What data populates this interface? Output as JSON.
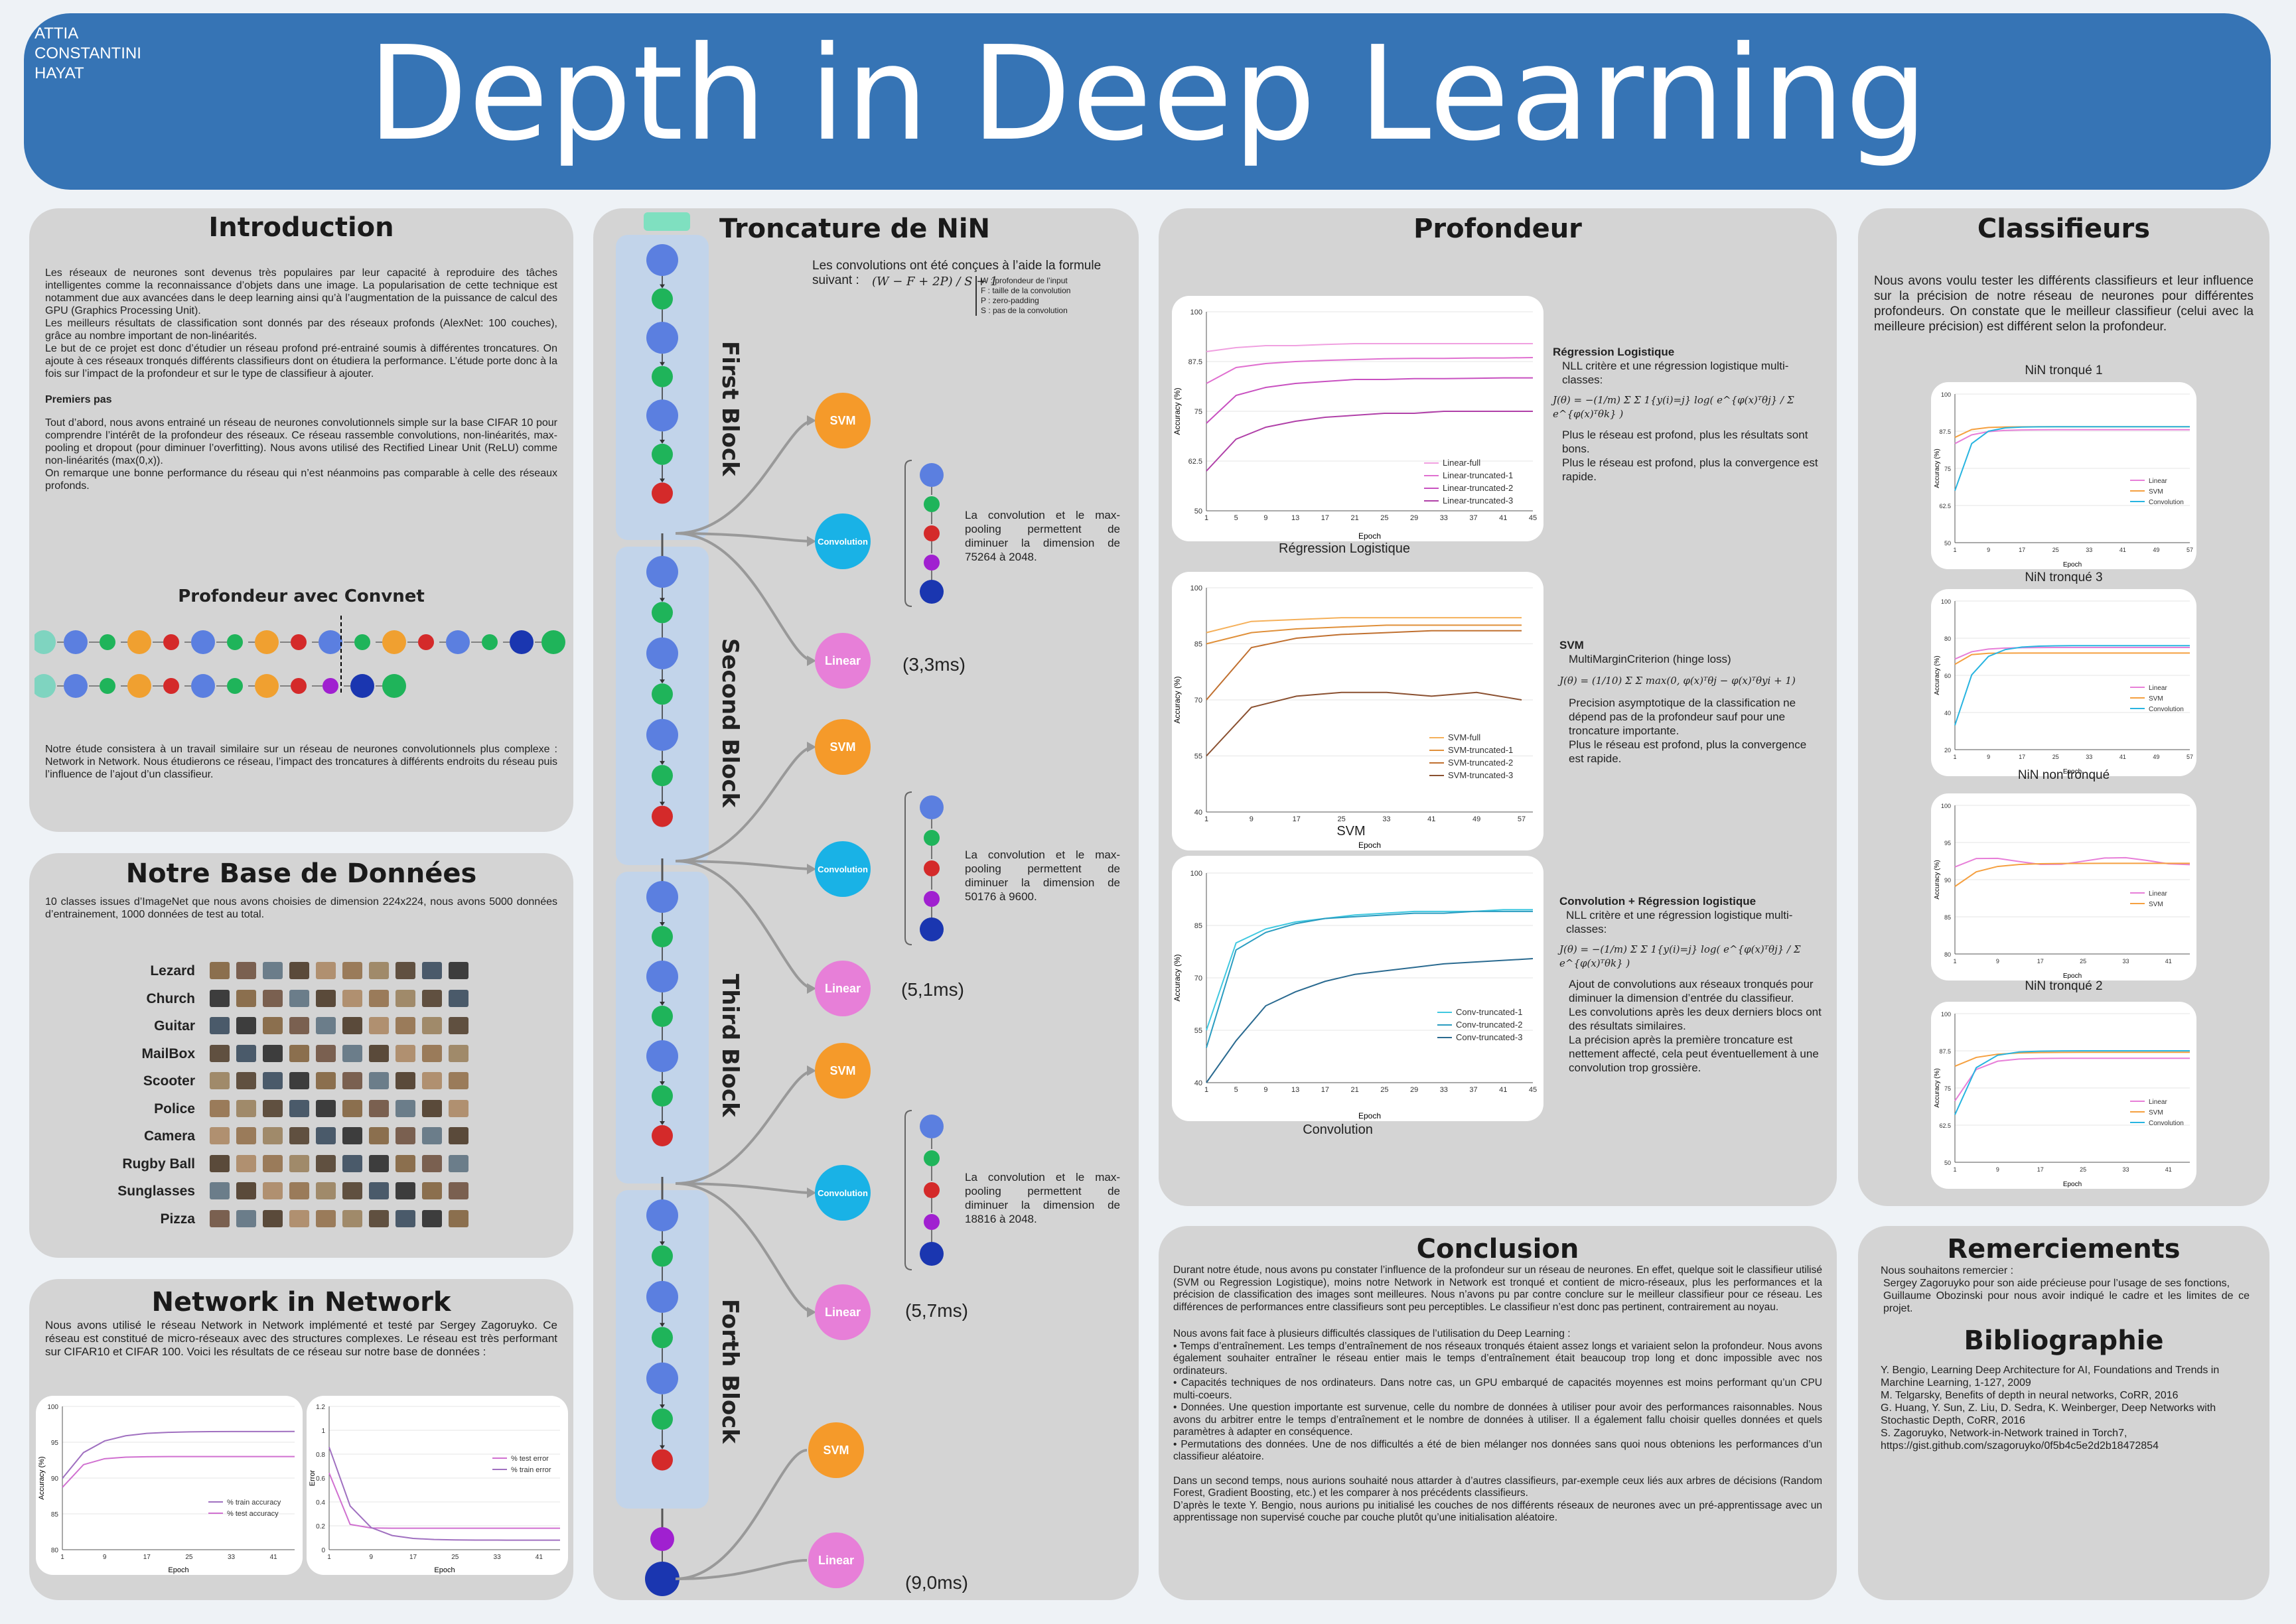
{
  "header": {
    "authors": [
      "ATTIA",
      "CONSTANTINI",
      "HAYAT"
    ],
    "title": "Depth in Deep Learning"
  },
  "intro": {
    "title": "Introduction",
    "p1": "Les réseaux de neurones sont devenus très populaires par leur capacité à reproduire des tâches intelligentes comme la reconnaissance d’objets dans une image. La popularisation de cette technique est notamment due aux avancées dans le deep learning ainsi qu’à l’augmentation de la puissance de calcul des GPU (Graphics Processing Unit).",
    "p2": "Les meilleurs résultats de classification sont donnés par des réseaux profonds (AlexNet: 100 couches), grâce au nombre important de non-linéarités.",
    "p3": "Le but de ce projet est donc d’étudier un réseau profond pré-entrainé soumis à différentes troncatures. On ajoute à ces réseaux tronqués différents classifieurs dont on étudiera la performance. L’étude porte donc à la fois sur l’impact de la profondeur et sur le type de classifieur à ajouter.",
    "subtitle": "Premiers pas",
    "p4": "Tout d’abord, nous avons entrainé un réseau de neurones convolutionnels simple sur la base CIFAR 10 pour comprendre l’intérêt de la profondeur des réseaux. Ce réseau rassemble convolutions, non-linéarités, max-pooling et dropout (pour diminuer l’overfitting). Nous avons utilisé des Rectified Linear Unit (ReLU) comme non-linéarités (max(0,x)).",
    "p5": "On remarque une bonne performance du réseau qui n’est néanmoins pas comparable à celle des réseaux profonds.",
    "convnet_title": "Profondeur avec Convnet",
    "p6": "Notre étude consistera à un travail similaire sur un réseau de neurones convolutionnels plus complexe : Network in Network. Nous étudierons ce réseau, l’impact des troncatures à différents endroits du réseau puis l’influence de l’ajout d’un classifieur."
  },
  "database": {
    "title": "Notre Base de Données",
    "text": "10 classes issues d’ImageNet que nous avons choisies de dimension 224x224, nous avons 5000 données d’entrainement, 1000 données de test au total.",
    "classes": [
      "Lezard",
      "Church",
      "Guitar",
      "MailBox",
      "Scooter",
      "Police",
      "Camera",
      "Rugby Ball",
      "Sunglasses",
      "Pizza"
    ]
  },
  "nin": {
    "title": "Network in Network",
    "text": "Nous avons utilisé le réseau Network in Network implémenté et testé par Sergey Zagoruyko. Ce réseau est constitué de micro-réseaux avec des structures complexes. Le réseau est très performant sur CIFAR10 et CIFAR 100. Voici les résultats de ce réseau sur notre base de données :",
    "chart1_legend": [
      "% train accuracy",
      "% test accuracy"
    ],
    "chart2_legend": [
      "% test error",
      "% train error"
    ],
    "xlabel": "Epoch",
    "ylabel1": "Accuracy (%)",
    "ylabel2": "Error"
  },
  "troncature": {
    "title": "Troncature de NiN",
    "formula_intro": "Les convolutions ont été conçues à l’aide la formule suivant :",
    "formula": "(W − F + 2P) / S + 1",
    "formula_notes": [
      "W : profondeur de l’input",
      "F : taille de la convolution",
      "P : zero-padding",
      "S : pas de la convolution"
    ],
    "blocks": [
      "First Block",
      "Second Block",
      "Third Block",
      "Forth Block"
    ],
    "svm": "SVM",
    "conv": "Convolution",
    "linear": "Linear",
    "desc1": "La convolution et le max-pooling permettent de diminuer la dimension de 75264 à 2048.",
    "desc2": "La convolution et le max-pooling permettent de diminuer la dimension de 50176 à 9600.",
    "desc3": "La convolution et le max-pooling permettent de diminuer la dimension de 18816 à 2048.",
    "times": [
      "(3,3ms)",
      "(5,1ms)",
      "(5,7ms)",
      "(9,0ms)"
    ]
  },
  "profondeur": {
    "title": "Profondeur",
    "chart1_caption": "Régression Logistique",
    "chart2_caption": "SVM",
    "chart3_caption": "Convolution",
    "xlabel": "Epoch",
    "ylabel": "Accuracy (%)",
    "chart1_legend": [
      "Linear-full",
      "Linear-truncated-1",
      "Linear-truncated-2",
      "Linear-truncated-3"
    ],
    "chart2_legend": [
      "SVM-full",
      "SVM-truncated-1",
      "SVM-truncated-2",
      "SVM-truncated-3"
    ],
    "chart3_legend": [
      "Conv-truncated-1",
      "Conv-truncated-2",
      "Conv-truncated-3"
    ],
    "s1_title": "Régression Logistique",
    "s1_b1": "NLL critère et une régression logistique multi-classes:",
    "s1_formula": "J(θ) = −(1/m) Σ Σ 1{y(i)=j} log( e^{φ(x)ᵀθj} / Σ e^{φ(x)ᵀθk} )",
    "s1_b2": "Plus le réseau est profond, plus les résultats sont bons.",
    "s1_b3": "Plus le réseau est profond, plus la convergence est rapide.",
    "s2_title": "SVM",
    "s2_b1": "MultiMarginCriterion (hinge loss)",
    "s2_formula": "J(θ) = (1/10) Σ Σ max(0, φ(x)ᵀθj − φ(x)ᵀθyi + 1)",
    "s2_b2": "Precision asymptotique de la classification ne dépend pas de la profondeur sauf pour une troncature importante.",
    "s2_b3": "Plus le réseau est profond, plus la convergence est rapide.",
    "s3_title": "Convolution + Régression logistique",
    "s3_b1": "NLL critère et une régression logistique multi-classes:",
    "s3_formula": "J(θ) = −(1/m) Σ Σ 1{y(i)=j} log( e^{φ(x)ᵀθj} / Σ e^{φ(x)ᵀθk} )",
    "s3_b2": "Ajout de convolutions aux réseaux tronqués pour diminuer la dimension d’entrée du classifieur.",
    "s3_b3": "Les convolutions après les deux derniers blocs ont des résultats similaires.",
    "s3_b4": "La précision après la première troncature est nettement affecté, cela peut éventuellement à une convolution trop grossière."
  },
  "classifieurs": {
    "title": "Classifieurs",
    "text": "Nous avons voulu tester les différents classifieurs et leur influence sur la précision de notre réseau de neurones pour différentes profondeurs. On constate que le meilleur classifieur (celui avec la meilleure précision) est différent selon la profondeur.",
    "charts": [
      {
        "title": "NiN tronqué 1",
        "legend": [
          "Linear",
          "SVM",
          "Convolution"
        ]
      },
      {
        "title": "NiN tronqué 3",
        "legend": [
          "Linear",
          "SVM",
          "Convolution"
        ]
      },
      {
        "title": "NiN non tronqué",
        "legend": [
          "Linear",
          "SVM"
        ]
      },
      {
        "title": "NiN tronqué 2",
        "legend": [
          "Linear",
          "SVM",
          "Convolution"
        ]
      }
    ],
    "xlabel": "Epoch",
    "ylabel": "Accuracy (%)"
  },
  "conclusion": {
    "title": "Conclusion",
    "p1": "Durant notre étude, nous avons pu constater l’influence de la profondeur sur un réseau de neurones. En effet, quelque soit le classifieur utilisé (SVM ou Regression Logistique), moins notre Network in Network est tronqué et contient de micro-réseaux, plus les performances et la précision de classification des images sont meilleures. Nous n’avons pu par contre conclure sur le meilleur classifieur pour ce réseau. Les différences de performances entre classifieurs sont peu perceptibles. Le classifieur n’est donc pas pertinent, contrairement au noyau.",
    "p2": "Nous avons fait face à plusieurs difficultés classiques de l’utilisation du Deep Learning :",
    "b1": "• Temps d’entraînement. Les temps d’entraînement de nos réseaux tronqués étaient assez longs et variaient selon la profondeur. Nous avons également souhaiter entraîner le réseau entier mais le temps d’entraînement était beaucoup trop long et donc impossible avec nos ordinateurs.",
    "b2": "• Capacités techniques de nos ordinateurs. Dans notre cas, un GPU embarqué de capacités moyennes est moins performant qu’un CPU multi-coeurs.",
    "b3": "• Données. Une question importante est survenue, celle du nombre de données à utiliser pour avoir des performances raisonnables. Nous avons du arbitrer entre le temps d’entraînement et le nombre de données à utiliser. Il a également fallu choisir quelles données et quels paramètres à adapter en conséquence.",
    "b4": "• Permutations des données. Une de nos difficultés a été de bien mélanger nos données sans quoi nous obtenions les performances d’un classifieur aléatoire.",
    "p3": "Dans un second temps, nous aurions souhaité nous attarder à d’autres classifieurs, par-exemple ceux liés aux arbres de décisions (Random Forest, Gradient Boosting, etc.) et les comparer à nos précédents classifieurs.",
    "p4": "D’après le texte Y. Bengio, nous aurions pu initialisé les couches de nos différents réseaux de neurones avec un pré-apprentissage avec un apprentissage non supervisé couche par couche plutôt qu’une initialisation aléatoire."
  },
  "remerciements": {
    "title": "Remerciements",
    "intro": "Nous souhaitons remercier :",
    "r1": "Sergey Zagoruyko pour son aide précieuse pour l’usage de ses fonctions,",
    "r2": "Guillaume Obozinski pour nous avoir indiqué le cadre et les limites de ce projet."
  },
  "bibliographie": {
    "title": "Bibliographie",
    "refs": [
      "Y. Bengio, Learning Deep Architecture for AI, Foundations and Trends in Marchine Learning, 1-127, 2009",
      "M. Telgarsky, Benefits of depth in neural networks, CoRR, 2016",
      "G. Huang, Y. Sun, Z. Liu, D. Sedra, K. Weinberger, Deep Networks with Stochastic Depth, CoRR, 2016",
      "S. Zagoruyko, Network-in-Network trained in Torch7, https://gist.github.com/szagoruyko/0f5b4c5e2d2b18472854"
    ]
  },
  "colors": {
    "banner": "#3674b5",
    "panel": "#d4d4d4",
    "svm": "#f59a2a",
    "conv": "#19b2e6",
    "linear": "#e77fd8",
    "block_bg": "#c2d4ea"
  },
  "chart_data": [
    {
      "type": "line",
      "title": "Régression Logistique",
      "xlabel": "Epoch",
      "ylabel": "Accuracy (%)",
      "ylim": [
        50,
        100
      ],
      "x": [
        1,
        5,
        9,
        13,
        17,
        21,
        25,
        29,
        33,
        37,
        41,
        45
      ],
      "series": [
        {
          "name": "Linear-full",
          "values": [
            90,
            91,
            91.5,
            91.5,
            91.8,
            92,
            92,
            92,
            92,
            92,
            92,
            92
          ]
        },
        {
          "name": "Linear-truncated-1",
          "values": [
            82,
            86,
            87,
            87.5,
            87.8,
            88,
            88.2,
            88.3,
            88.3,
            88.4,
            88.4,
            88.5
          ]
        },
        {
          "name": "Linear-truncated-2",
          "values": [
            72,
            79,
            81,
            82,
            82.5,
            83,
            83,
            83.2,
            83.2,
            83.3,
            83.4,
            83.4
          ]
        },
        {
          "name": "Linear-truncated-3",
          "values": [
            60,
            68,
            71,
            72.5,
            73.5,
            74,
            74.5,
            74.5,
            75,
            75,
            75,
            75
          ]
        }
      ]
    },
    {
      "type": "line",
      "title": "SVM",
      "xlabel": "Epoch",
      "ylabel": "Accuracy (%)",
      "ylim": [
        40,
        100
      ],
      "x": [
        1,
        9,
        17,
        25,
        33,
        41,
        49,
        57
      ],
      "series": [
        {
          "name": "SVM-full",
          "values": [
            88,
            91,
            91.5,
            92,
            92,
            92,
            92,
            92
          ]
        },
        {
          "name": "SVM-truncated-1",
          "values": [
            85,
            88,
            89,
            89.5,
            90,
            90,
            90,
            90
          ]
        },
        {
          "name": "SVM-truncated-2",
          "values": [
            70,
            84,
            86.5,
            87.5,
            88,
            88.5,
            88.5,
            88.5
          ]
        },
        {
          "name": "SVM-truncated-3",
          "values": [
            55,
            68,
            71,
            72,
            72,
            71,
            72,
            70
          ]
        }
      ]
    },
    {
      "type": "line",
      "title": "Convolution",
      "xlabel": "Epoch",
      "ylabel": "Accuracy (%)",
      "ylim": [
        40,
        100
      ],
      "x": [
        1,
        5,
        9,
        13,
        17,
        21,
        25,
        29,
        33,
        37,
        41,
        45
      ],
      "series": [
        {
          "name": "Conv-truncated-1",
          "values": [
            55,
            80,
            84,
            86,
            87,
            88,
            88.5,
            89,
            89,
            89,
            89.5,
            89.5
          ]
        },
        {
          "name": "Conv-truncated-2",
          "values": [
            50,
            78,
            83,
            85.5,
            87,
            87.5,
            88,
            88.5,
            88.5,
            89,
            89,
            89
          ]
        },
        {
          "name": "Conv-truncated-3",
          "values": [
            40,
            52,
            62,
            66,
            69,
            71,
            72,
            73,
            74,
            74.5,
            75,
            75.5
          ]
        }
      ]
    }
  ]
}
